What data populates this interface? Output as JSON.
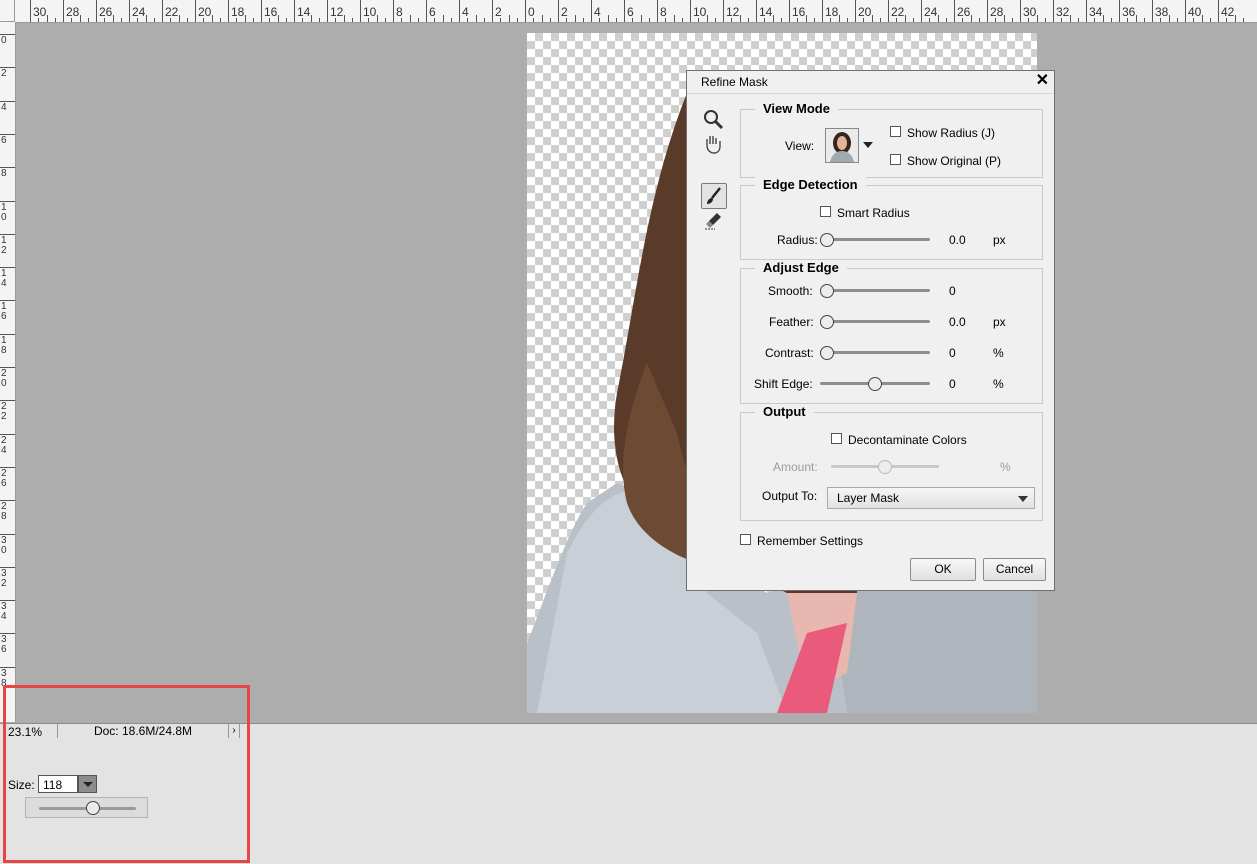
{
  "rulers": {
    "top": [
      "30",
      "28",
      "26",
      "24",
      "22",
      "20",
      "18",
      "16",
      "14",
      "12",
      "10",
      "8",
      "6",
      "4",
      "2",
      "0",
      "2",
      "4",
      "6",
      "8",
      "10",
      "12",
      "14",
      "16",
      "18",
      "20",
      "22",
      "24",
      "26",
      "28",
      "30",
      "32",
      "34",
      "36",
      "38",
      "40",
      "42"
    ],
    "left": [
      "0",
      "2",
      "4",
      "6",
      "8",
      "10",
      "12",
      "14",
      "16",
      "18",
      "20",
      "22",
      "24",
      "26",
      "28",
      "30",
      "32",
      "34",
      "36",
      "38"
    ]
  },
  "statusbar": {
    "zoom": "23.1%",
    "doc": "Doc: 18.6M/24.8M",
    "arrow": "›"
  },
  "options": {
    "size_label": "Size:",
    "size_value": "118",
    "brush_size_level": 0.55
  },
  "dialog": {
    "title": "Refine Mask",
    "view_mode": {
      "title": "View Mode",
      "view_label": "View:",
      "show_radius": "Show Radius (J)",
      "show_original": "Show Original (P)"
    },
    "edge_detection": {
      "title": "Edge Detection",
      "smart_radius": "Smart Radius",
      "radius_label": "Radius:",
      "radius_value": "0.0",
      "radius_unit": "px",
      "radius_level": 0
    },
    "adjust_edge": {
      "title": "Adjust Edge",
      "smooth_label": "Smooth:",
      "smooth_value": "0",
      "smooth_level": 0,
      "feather_label": "Feather:",
      "feather_value": "0.0",
      "feather_unit": "px",
      "feather_level": 0,
      "contrast_label": "Contrast:",
      "contrast_value": "0",
      "contrast_unit": "%",
      "contrast_level": 0,
      "shift_label": "Shift Edge:",
      "shift_value": "0",
      "shift_unit": "%",
      "shift_level": 0.5
    },
    "output": {
      "title": "Output",
      "decontaminate": "Decontaminate Colors",
      "amount_label": "Amount:",
      "amount_unit": "%",
      "amount_level": 0.5,
      "output_to_label": "Output To:",
      "output_to_value": "Layer Mask"
    },
    "remember": "Remember Settings",
    "ok": "OK",
    "cancel": "Cancel"
  }
}
